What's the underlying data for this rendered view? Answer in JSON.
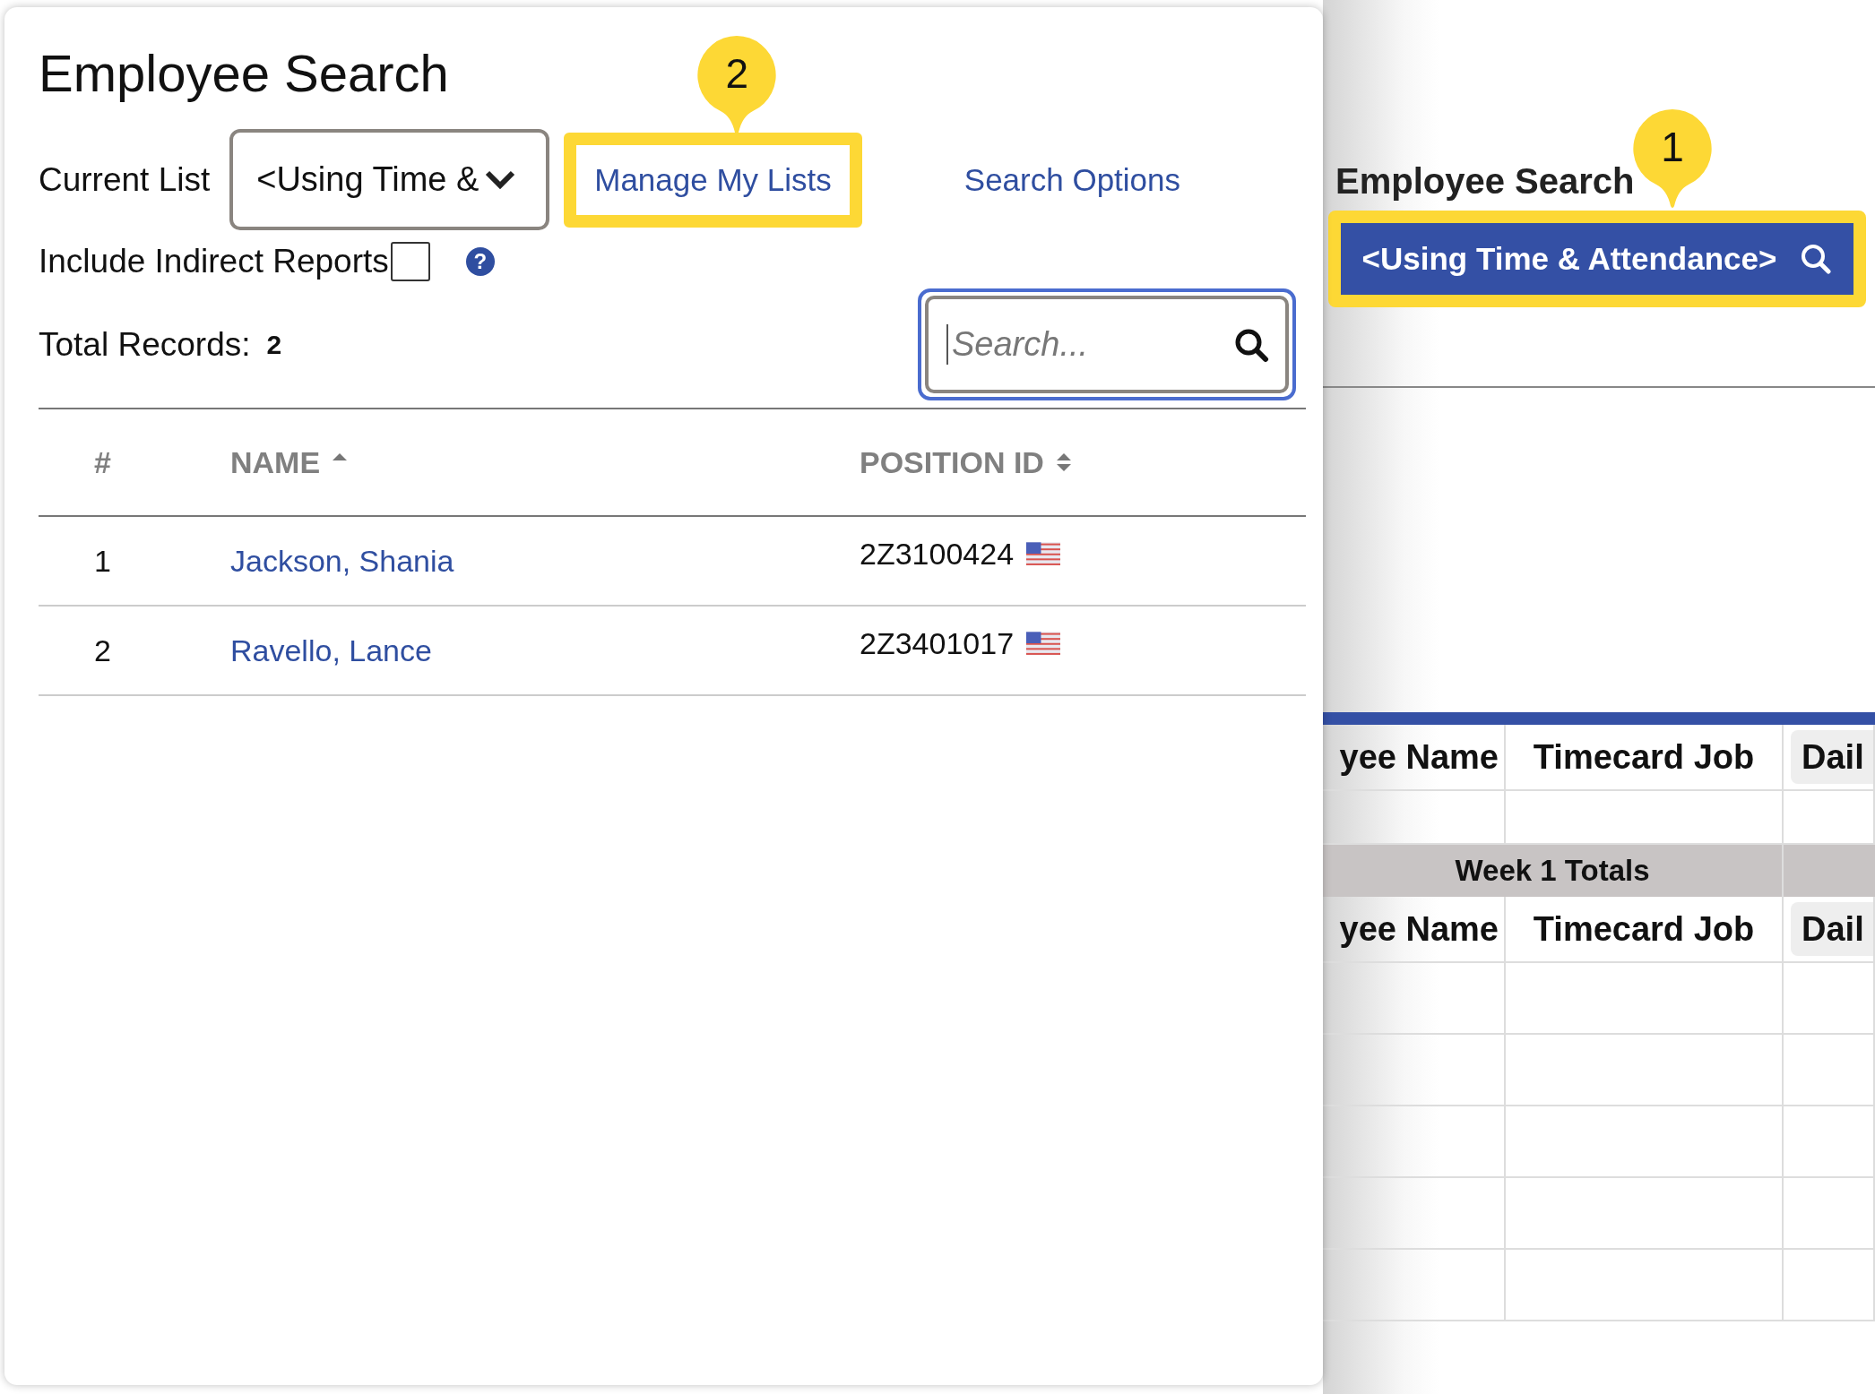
{
  "dialog": {
    "title": "Employee Search",
    "current_list": {
      "label": "Current List",
      "value": "<Using Time &"
    },
    "links": [
      {
        "label": "Manage My Lists",
        "highlighted": true,
        "callout": "2"
      },
      {
        "label": "Search Options",
        "highlighted": false
      }
    ],
    "include_indirect": {
      "label": "Include Indirect Reports",
      "checked": false,
      "help": "?"
    },
    "total_records": {
      "label": "Total Records:",
      "value": "2"
    },
    "search": {
      "placeholder": "Search..."
    },
    "table": {
      "columns": [
        {
          "label": "#",
          "kind": "plain"
        },
        {
          "label": "NAME",
          "kind": "sorted"
        },
        {
          "label": "POSITION ID",
          "kind": "sortable"
        }
      ],
      "rows": [
        {
          "number": "1",
          "name": "Jackson, Shania",
          "position_id": "2Z3100424"
        },
        {
          "number": "2",
          "name": "Ravello, Lance",
          "position_id": "2Z3401017"
        }
      ]
    }
  },
  "background": {
    "title": "Employee Search",
    "list_button": {
      "label": "<Using Time & Attendance>",
      "highlighted": true,
      "callout": "1"
    },
    "table": {
      "rows": [
        {
          "kind": "header",
          "cells": [
            "yee Name",
            "Timecard Job",
            "Dail"
          ]
        },
        {
          "kind": "blank"
        },
        {
          "kind": "total",
          "label": "Week 1 Totals"
        },
        {
          "kind": "header",
          "cells": [
            "yee Name",
            "Timecard Job",
            "Dail"
          ]
        },
        {
          "kind": "blank"
        },
        {
          "kind": "blank"
        },
        {
          "kind": "blank"
        },
        {
          "kind": "blank"
        },
        {
          "kind": "blank"
        }
      ]
    }
  }
}
